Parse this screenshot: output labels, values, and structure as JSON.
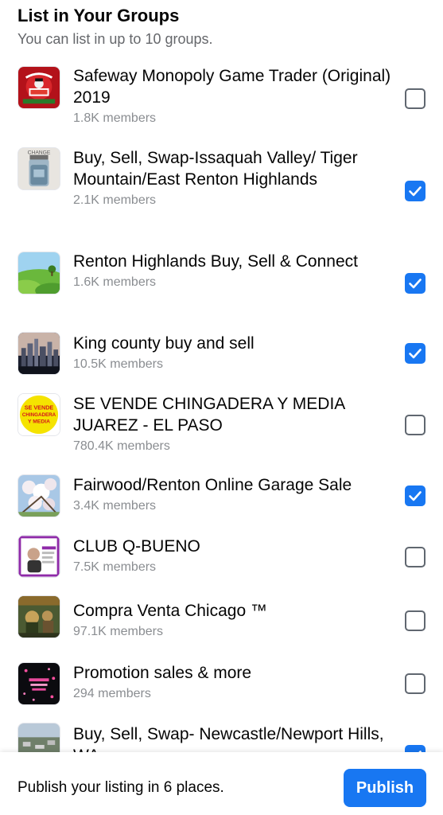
{
  "header": {
    "title": "List in Your Groups",
    "subtitle": "You can list in up to 10 groups."
  },
  "groups": [
    {
      "name": "Safeway Monopoly Game Trader (Original) 2019",
      "members": "1.8K members",
      "checked": false,
      "thumb_icon": "monopoly-thumbnail"
    },
    {
      "name": "Buy, Sell, Swap-Issaquah Valley/ Tiger Mountain/East Renton Highlands",
      "members": "2.1K members",
      "checked": true,
      "thumb_icon": "mason-jar-thumbnail"
    },
    {
      "name": "Renton Highlands Buy, Sell & Connect",
      "members": "1.6K members",
      "checked": true,
      "thumb_icon": "green-hills-thumbnail"
    },
    {
      "name": "King county buy and sell",
      "members": "10.5K members",
      "checked": true,
      "thumb_icon": "city-skyline-thumbnail"
    },
    {
      "name": "SE VENDE CHINGADERA Y MEDIA JUAREZ - EL PASO",
      "members": "780.4K members",
      "checked": false,
      "thumb_icon": "yellow-circle-logo-thumbnail",
      "thumb_text": [
        "SE VENDE",
        "CHINGADERA",
        "Y MEDIA"
      ]
    },
    {
      "name": "Fairwood/Renton Online Garage Sale",
      "members": "3.4K members",
      "checked": true,
      "thumb_icon": "cherry-blossom-thumbnail"
    },
    {
      "name": "CLUB Q-BUENO",
      "members": "7.5K members",
      "checked": false,
      "thumb_icon": "club-flyer-thumbnail"
    },
    {
      "name": "Compra Venta Chicago ™",
      "members": "97.1K members",
      "checked": false,
      "thumb_icon": "vintage-painting-thumbnail"
    },
    {
      "name": "Promotion sales & more",
      "members": "294 members",
      "checked": false,
      "thumb_icon": "pink-sparkle-thumbnail"
    },
    {
      "name": "Buy, Sell, Swap- Newcastle/Newport Hills, WA",
      "members": "",
      "checked": true,
      "thumb_icon": "aerial-view-thumbnail"
    }
  ],
  "footer": {
    "text": "Publish your listing in 6 places.",
    "publish_label": "Publish"
  },
  "colors": {
    "accent": "#1877f2",
    "secondary_text": "#8a8d91",
    "subtitle": "#65676b"
  }
}
